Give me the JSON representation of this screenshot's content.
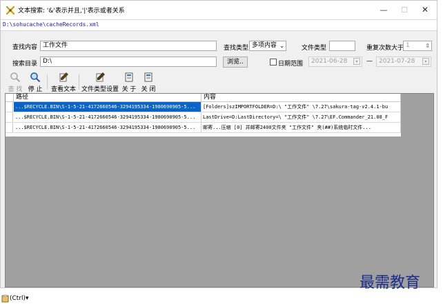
{
  "window": {
    "title": "文本搜索: '&'表示并且,'|'表示或者关系",
    "controls": {
      "minimize": "—",
      "maximize": "☐",
      "close": "✕"
    }
  },
  "path": "D:\\sohucache\\cacheRecords.xml",
  "search": {
    "content_label": "查找内容",
    "content_value": "工作文件",
    "type_label": "查找类型",
    "type_value": "多项内容",
    "filetype_label": "文件类型",
    "filetype_value": "",
    "repeat_label": "重复次数大于",
    "repeat_value": "1",
    "dir_label": "搜索目录",
    "dir_value": "D:\\",
    "browse_label": "浏览..",
    "date_label": "日期范围",
    "date_checked": false,
    "date_from": "2021-06-28",
    "date_sep": "—",
    "date_to": "2021-07-28"
  },
  "toolbar": {
    "items": [
      {
        "label": "查 找",
        "icon": "magnifier-icon",
        "enabled": false
      },
      {
        "label": "停 止",
        "icon": "stop-search-icon",
        "enabled": true
      },
      {
        "label": "查看文本",
        "icon": "view-text-icon",
        "enabled": true
      },
      {
        "label": "文件类型设置",
        "icon": "filetype-settings-icon",
        "enabled": true
      },
      {
        "label": "关 于",
        "icon": "about-icon",
        "enabled": true
      },
      {
        "label": "关 闭",
        "icon": "close-doc-icon",
        "enabled": true
      }
    ]
  },
  "table": {
    "columns": [
      "路径",
      "内容"
    ],
    "rows": [
      {
        "path": "...$RECYCLE.BIN\\S-1-5-21-4172660546-3294195334-1980690905-5...",
        "content": "[Folders]szIMPORTFOLDER=D:\\ \"工作文件\" \\7.27\\sakura-tag-v2.4.1-bu",
        "selected": true
      },
      {
        "path": "...$RECYCLE.BIN\\S-1-5-21-4172660546-3294195334-1980690905-5...",
        "content": "LastDrive=D:LastDirectory=\\ \"工作文件\" \\7.27\\EF.Commander_21.08_F",
        "selected": false
      },
      {
        "path": "...$RECYCLE.BIN\\S-1-5-21-4172660546-3294195334-1980690905-5...",
        "content": "邮寄...压缩 [0] 并邮寄2400文件夹 \"工作文件\" 夹(##)系统临时文件...",
        "selected": false
      }
    ]
  },
  "watermark": "最需教育",
  "paste_widget": {
    "label": "(Ctrl)",
    "arrow": "▾"
  }
}
